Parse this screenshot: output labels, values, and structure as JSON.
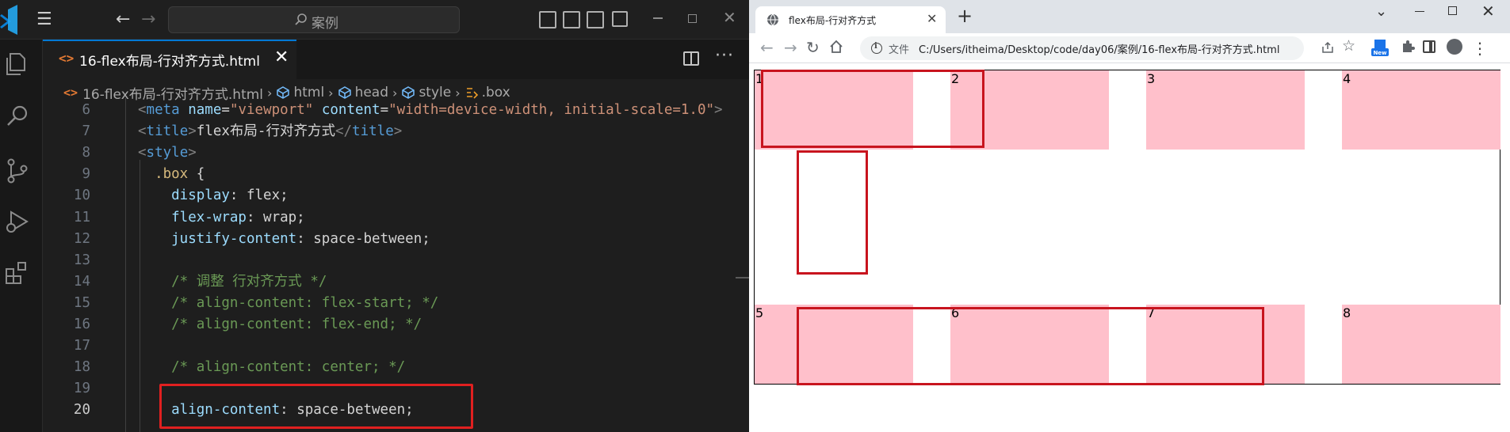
{
  "vscode": {
    "search_text": "案例",
    "tab": {
      "icon": "<>",
      "label": "16-flex布局-行对齐方式.html",
      "close": "✕"
    },
    "breadcrumb": {
      "file": "16-flex布局-行对齐方式.html",
      "items": [
        "html",
        "head",
        "style",
        ".box"
      ]
    },
    "code_lines": [
      {
        "num": "6",
        "segments": [
          {
            "t": "<",
            "c": "t-punct"
          },
          {
            "t": "meta",
            "c": "t-tag"
          },
          {
            "t": " name",
            "c": "t-attr"
          },
          {
            "t": "=",
            "c": "t-text"
          },
          {
            "t": "\"viewport\"",
            "c": "t-str"
          },
          {
            "t": " content",
            "c": "t-attr"
          },
          {
            "t": "=",
            "c": "t-text"
          },
          {
            "t": "\"width=device-width, initial-scale=1.0\"",
            "c": "t-str"
          },
          {
            "t": ">",
            "c": "t-punct"
          }
        ]
      },
      {
        "num": "7",
        "segments": [
          {
            "t": "<",
            "c": "t-punct"
          },
          {
            "t": "title",
            "c": "t-tag"
          },
          {
            "t": ">",
            "c": "t-punct"
          },
          {
            "t": "flex布局-行对齐方式",
            "c": "t-text"
          },
          {
            "t": "</",
            "c": "t-punct"
          },
          {
            "t": "title",
            "c": "t-tag"
          },
          {
            "t": ">",
            "c": "t-punct"
          }
        ]
      },
      {
        "num": "8",
        "segments": [
          {
            "t": "<",
            "c": "t-punct"
          },
          {
            "t": "style",
            "c": "t-tag"
          },
          {
            "t": ">",
            "c": "t-punct"
          }
        ]
      },
      {
        "num": "9",
        "segments": [
          {
            "t": "  .box",
            "c": "t-sel"
          },
          {
            "t": " {",
            "c": "t-text"
          }
        ]
      },
      {
        "num": "10",
        "segments": [
          {
            "t": "    display",
            "c": "t-prop"
          },
          {
            "t": ": flex;",
            "c": "t-text"
          }
        ]
      },
      {
        "num": "11",
        "segments": [
          {
            "t": "    flex-wrap",
            "c": "t-prop"
          },
          {
            "t": ": wrap;",
            "c": "t-text"
          }
        ]
      },
      {
        "num": "12",
        "segments": [
          {
            "t": "    justify-content",
            "c": "t-prop"
          },
          {
            "t": ": space-between;",
            "c": "t-text"
          }
        ]
      },
      {
        "num": "13",
        "segments": []
      },
      {
        "num": "14",
        "segments": [
          {
            "t": "    /* 调整 行对齐方式 */",
            "c": "t-comment"
          }
        ]
      },
      {
        "num": "15",
        "segments": [
          {
            "t": "    /* align-content: flex-start; */",
            "c": "t-comment"
          }
        ]
      },
      {
        "num": "16",
        "segments": [
          {
            "t": "    /* align-content: flex-end; */",
            "c": "t-comment"
          }
        ]
      },
      {
        "num": "17",
        "segments": []
      },
      {
        "num": "18",
        "segments": [
          {
            "t": "    /* align-content: center; */",
            "c": "t-comment"
          }
        ]
      },
      {
        "num": "19",
        "segments": []
      },
      {
        "num": "20",
        "segments": [
          {
            "t": "    align-content",
            "c": "t-prop"
          },
          {
            "t": ": space-between;",
            "c": "t-text"
          }
        ]
      }
    ]
  },
  "browser": {
    "tab_title": "flex布局-行对齐方式",
    "file_label": "文件",
    "url": "C:/Users/itheima/Desktop/code/day06/案例/16-flex布局-行对齐方式.html",
    "ext_badge": "New",
    "flex_items": [
      "1",
      "2",
      "3",
      "4",
      "5",
      "6",
      "7",
      "8"
    ]
  },
  "colors": {
    "item_bg": "#ffc0cb",
    "annotation_red": "#c8141e",
    "editor_bg": "#1e1e1e"
  }
}
